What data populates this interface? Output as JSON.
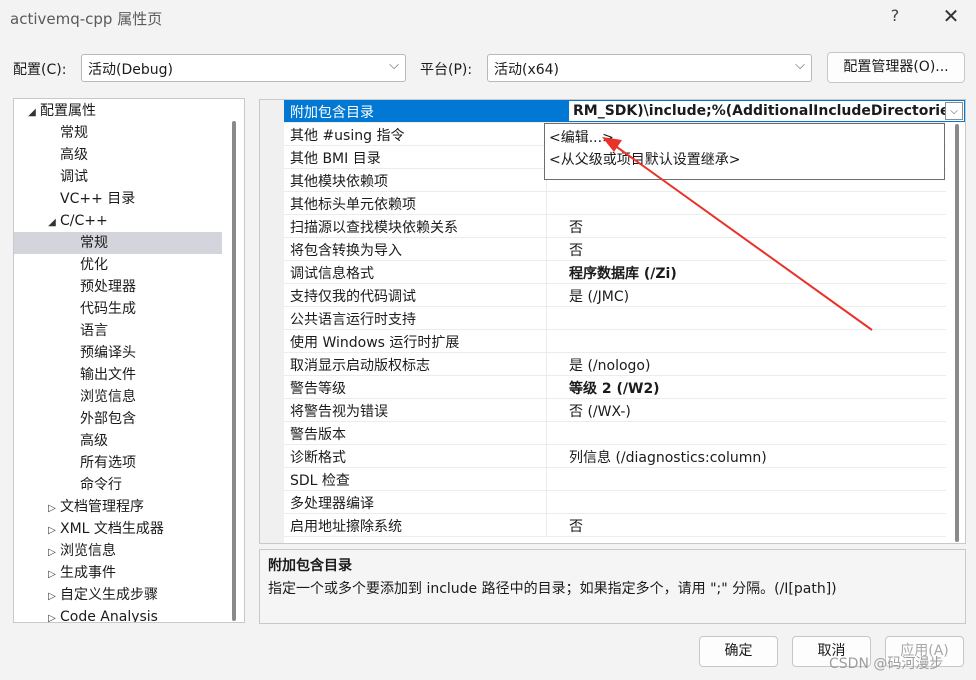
{
  "window": {
    "title": "activemq-cpp 属性页",
    "help_glyph": "?",
    "close_glyph": "✕"
  },
  "toolbar": {
    "config_label": "配置(C):",
    "config_value": "活动(Debug)",
    "platform_label": "平台(P):",
    "platform_value": "活动(x64)",
    "config_manager_button": "配置管理器(O)..."
  },
  "tree": {
    "items": [
      {
        "label": "配置属性",
        "arrow": "◢",
        "level": 0
      },
      {
        "label": "常规",
        "arrow": "",
        "level": 1
      },
      {
        "label": "高级",
        "arrow": "",
        "level": 1
      },
      {
        "label": "调试",
        "arrow": "",
        "level": 1
      },
      {
        "label": "VC++ 目录",
        "arrow": "",
        "level": 1
      },
      {
        "label": "C/C++",
        "arrow": "◢",
        "level": 1
      },
      {
        "label": "常规",
        "arrow": "",
        "level": 2,
        "selected": true
      },
      {
        "label": "优化",
        "arrow": "",
        "level": 2
      },
      {
        "label": "预处理器",
        "arrow": "",
        "level": 2
      },
      {
        "label": "代码生成",
        "arrow": "",
        "level": 2
      },
      {
        "label": "语言",
        "arrow": "",
        "level": 2
      },
      {
        "label": "预编译头",
        "arrow": "",
        "level": 2
      },
      {
        "label": "输出文件",
        "arrow": "",
        "level": 2
      },
      {
        "label": "浏览信息",
        "arrow": "",
        "level": 2
      },
      {
        "label": "外部包含",
        "arrow": "",
        "level": 2
      },
      {
        "label": "高级",
        "arrow": "",
        "level": 2
      },
      {
        "label": "所有选项",
        "arrow": "",
        "level": 2
      },
      {
        "label": "命令行",
        "arrow": "",
        "level": 2
      },
      {
        "label": "文档管理程序",
        "arrow": "▷",
        "level": 1
      },
      {
        "label": "XML 文档生成器",
        "arrow": "▷",
        "level": 1
      },
      {
        "label": "浏览信息",
        "arrow": "▷",
        "level": 1
      },
      {
        "label": "生成事件",
        "arrow": "▷",
        "level": 1
      },
      {
        "label": "自定义生成步骤",
        "arrow": "▷",
        "level": 1
      },
      {
        "label": "Code Analysis",
        "arrow": "▷",
        "level": 1
      }
    ]
  },
  "grid": {
    "selected_row": {
      "name": "附加包含目录",
      "value": "RM_SDK)\\include;%(AdditionalIncludeDirectories)",
      "dropdown_glyph": "⌵"
    },
    "rows": [
      {
        "name": "其他 #using 指令",
        "value": "",
        "bold": false
      },
      {
        "name": "其他 BMI 目录",
        "value": "",
        "bold": false
      },
      {
        "name": "其他模块依赖项",
        "value": "",
        "bold": false
      },
      {
        "name": "其他标头单元依赖项",
        "value": "",
        "bold": false
      },
      {
        "name": "扫描源以查找模块依赖关系",
        "value": "否",
        "bold": false
      },
      {
        "name": "将包含转换为导入",
        "value": "否",
        "bold": false
      },
      {
        "name": "调试信息格式",
        "value": "程序数据库 (/Zi)",
        "bold": true
      },
      {
        "name": "支持仅我的代码调试",
        "value": "是 (/JMC)",
        "bold": false
      },
      {
        "name": "公共语言运行时支持",
        "value": "",
        "bold": false
      },
      {
        "name": "使用 Windows 运行时扩展",
        "value": "",
        "bold": false
      },
      {
        "name": "取消显示启动版权标志",
        "value": "是 (/nologo)",
        "bold": false
      },
      {
        "name": "警告等级",
        "value": "等级 2 (/W2)",
        "bold": true
      },
      {
        "name": "将警告视为错误",
        "value": "否 (/WX-)",
        "bold": false
      },
      {
        "name": "警告版本",
        "value": "",
        "bold": false
      },
      {
        "name": "诊断格式",
        "value": "列信息 (/diagnostics:column)",
        "bold": false
      },
      {
        "name": "SDL 检查",
        "value": "",
        "bold": false
      },
      {
        "name": "多处理器编译",
        "value": "",
        "bold": false
      },
      {
        "name": "启用地址擦除系统",
        "value": "否",
        "bold": false
      }
    ],
    "dropdown_items": [
      "<编辑...>",
      "<从父级或项目默认设置继承>"
    ]
  },
  "description": {
    "title": "附加包含目录",
    "text": "指定一个或多个要添加到 include 路径中的目录；如果指定多个，请用 \";\" 分隔。(/I[path])"
  },
  "buttons": {
    "ok": "确定",
    "cancel": "取消",
    "apply": "应用(A)"
  },
  "watermark": "CSDN @码河漫步",
  "colors": {
    "selection": "#0078d4",
    "tree_selection": "#d4d4dc",
    "annotation_arrow": "#e8332a"
  }
}
